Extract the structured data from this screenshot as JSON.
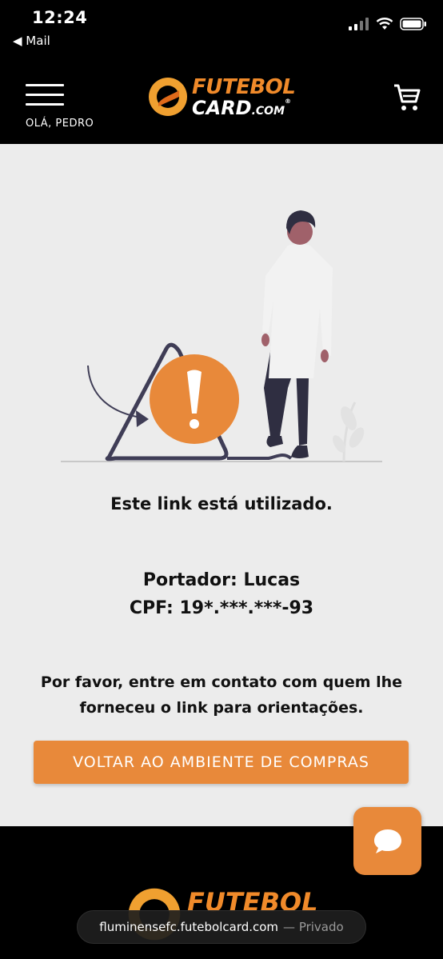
{
  "statusbar": {
    "time": "12:24",
    "back_label": "◀ Mail"
  },
  "header": {
    "greeting": "OLÁ, PEDRO",
    "logo_line1": "FUTEBOL",
    "logo_line2": "CARD",
    "logo_line2_suffix": ".COM",
    "logo_registered": "®",
    "menu_icon": "hamburger-menu-icon",
    "cart_icon": "shopping-cart-icon"
  },
  "main": {
    "exclamation": "!",
    "title": "Este link está utilizado.",
    "holder": "Portador: Lucas",
    "cpf": "CPF: 19*.***.***-93",
    "instruction_line1": "Por favor, entre em contato com quem lhe",
    "instruction_line2": "forneceu o link para orientações.",
    "button_label": "VOLTAR AO AMBIENTE DE COMPRAS"
  },
  "footer": {
    "logo_line1": "FUTEBOL",
    "chat_icon": "chat-bubble-icon"
  },
  "browser": {
    "url": "fluminensefc.futebolcard.com",
    "mode": "— Privado"
  },
  "colors": {
    "accent": "#e8893a",
    "background": "#ececec",
    "header_bg": "#000000",
    "text": "#111111"
  }
}
